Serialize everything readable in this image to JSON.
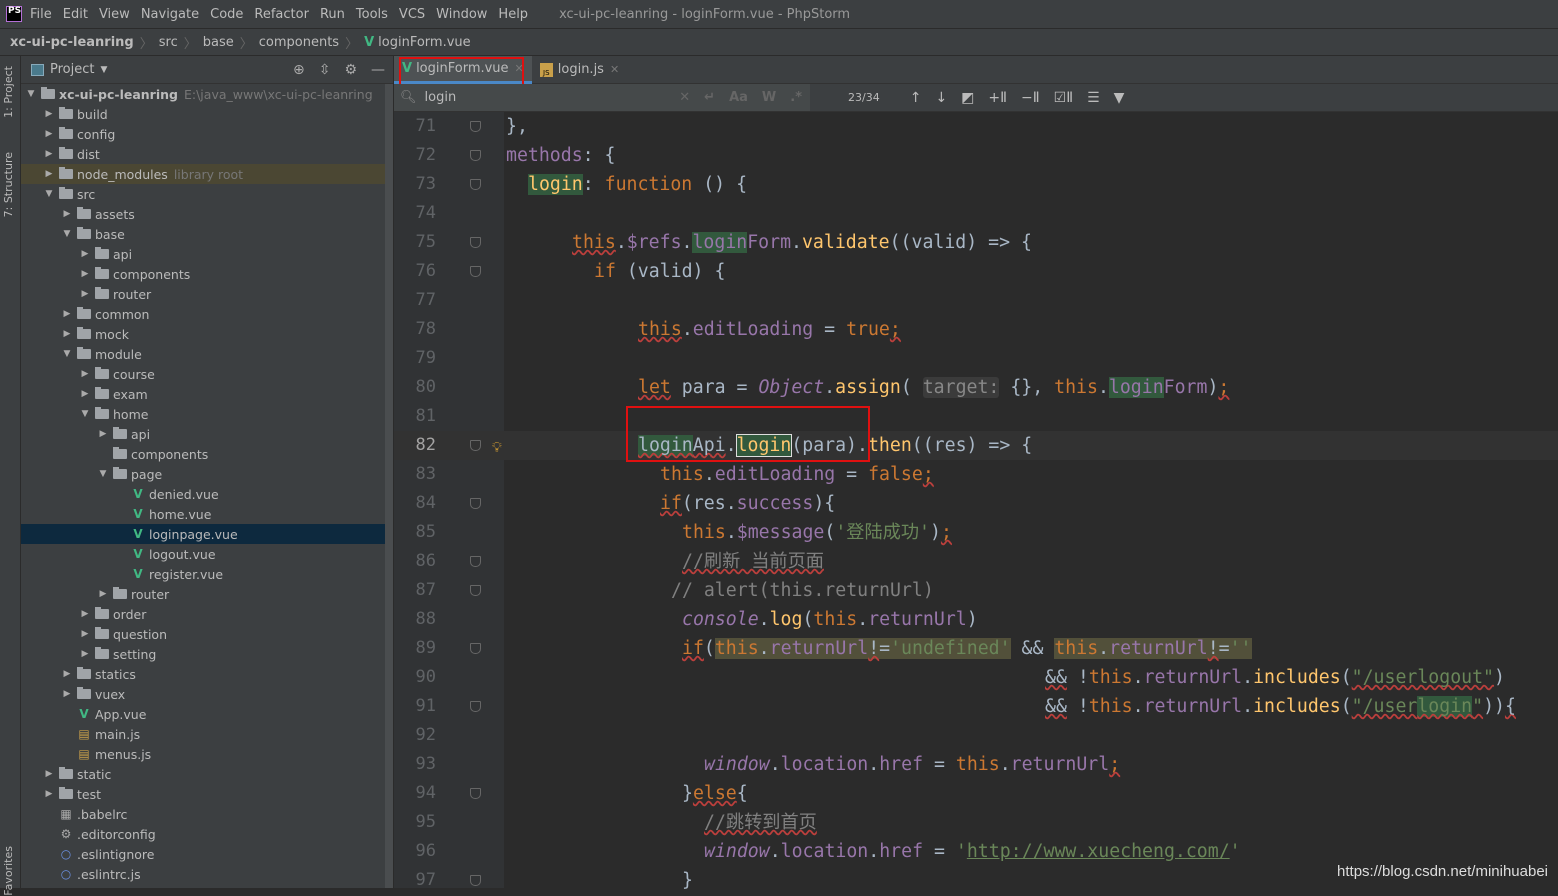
{
  "menubar": {
    "logo": "PS",
    "items": [
      "File",
      "Edit",
      "View",
      "Navigate",
      "Code",
      "Refactor",
      "Run",
      "Tools",
      "VCS",
      "Window",
      "Help"
    ],
    "title": "xc-ui-pc-leanring - loginForm.vue - PhpStorm"
  },
  "breadcrumb": [
    "xc-ui-pc-leanring",
    "src",
    "base",
    "components",
    "loginForm.vue"
  ],
  "side_tabs": {
    "project": "1: Project",
    "structure": "7: Structure",
    "favorites": "Favorites"
  },
  "project_panel": {
    "title": "Project",
    "tools": [
      "locate-icon",
      "collapse-icon",
      "gear-icon",
      "minimize-icon"
    ]
  },
  "tree": [
    {
      "l": 0,
      "t": "folder",
      "n": "xc-ui-pc-leanring",
      "o": true,
      "b": true,
      "x": "E:\\java_www\\xc-ui-pc-leanring"
    },
    {
      "l": 1,
      "t": "folder",
      "n": "build"
    },
    {
      "l": 1,
      "t": "folder",
      "n": "config"
    },
    {
      "l": 1,
      "t": "folder",
      "n": "dist"
    },
    {
      "l": 1,
      "t": "folder",
      "n": "node_modules",
      "x": "library root",
      "hl": true
    },
    {
      "l": 1,
      "t": "folder",
      "n": "src",
      "o": true
    },
    {
      "l": 2,
      "t": "folder",
      "n": "assets"
    },
    {
      "l": 2,
      "t": "folder",
      "n": "base",
      "o": true
    },
    {
      "l": 3,
      "t": "folder",
      "n": "api"
    },
    {
      "l": 3,
      "t": "folder",
      "n": "components"
    },
    {
      "l": 3,
      "t": "folder",
      "n": "router"
    },
    {
      "l": 2,
      "t": "folder",
      "n": "common"
    },
    {
      "l": 2,
      "t": "folder",
      "n": "mock"
    },
    {
      "l": 2,
      "t": "folder",
      "n": "module",
      "o": true
    },
    {
      "l": 3,
      "t": "folder",
      "n": "course"
    },
    {
      "l": 3,
      "t": "folder",
      "n": "exam"
    },
    {
      "l": 3,
      "t": "folder",
      "n": "home",
      "o": true
    },
    {
      "l": 4,
      "t": "folder",
      "n": "api"
    },
    {
      "l": 4,
      "t": "folder",
      "n": "components",
      "na": true
    },
    {
      "l": 4,
      "t": "folder",
      "n": "page",
      "o": true
    },
    {
      "l": 5,
      "t": "vue",
      "n": "denied.vue"
    },
    {
      "l": 5,
      "t": "vue",
      "n": "home.vue"
    },
    {
      "l": 5,
      "t": "vue",
      "n": "loginpage.vue",
      "sel": true
    },
    {
      "l": 5,
      "t": "vue",
      "n": "logout.vue"
    },
    {
      "l": 5,
      "t": "vue",
      "n": "register.vue"
    },
    {
      "l": 4,
      "t": "folder",
      "n": "router"
    },
    {
      "l": 3,
      "t": "folder",
      "n": "order"
    },
    {
      "l": 3,
      "t": "folder",
      "n": "question"
    },
    {
      "l": 3,
      "t": "folder",
      "n": "setting"
    },
    {
      "l": 2,
      "t": "folder",
      "n": "statics"
    },
    {
      "l": 2,
      "t": "folder",
      "n": "vuex"
    },
    {
      "l": 2,
      "t": "vue",
      "n": "App.vue"
    },
    {
      "l": 2,
      "t": "js",
      "n": "main.js"
    },
    {
      "l": 2,
      "t": "js",
      "n": "menus.js"
    },
    {
      "l": 1,
      "t": "folder",
      "n": "static"
    },
    {
      "l": 1,
      "t": "folder",
      "n": "test"
    },
    {
      "l": 1,
      "t": "babel",
      "n": ".babelrc"
    },
    {
      "l": 1,
      "t": "gear",
      "n": ".editorconfig"
    },
    {
      "l": 1,
      "t": "circle",
      "n": ".eslintignore"
    },
    {
      "l": 1,
      "t": "circle",
      "n": ".eslintrc.js"
    }
  ],
  "tabs": [
    {
      "label": "loginForm.vue",
      "icon": "vue",
      "active": true
    },
    {
      "label": "login.js",
      "icon": "js",
      "active": false
    }
  ],
  "search": {
    "query": "login",
    "match_count": "23/34",
    "options": [
      "Aa",
      "W",
      ".*"
    ]
  },
  "code": {
    "current_line": 82,
    "lines": [
      {
        "n": 71,
        "i": 0,
        "s": [
          [
            "d",
            "},"
          ]
        ]
      },
      {
        "n": 72,
        "i": 0,
        "s": [
          [
            "p",
            "methods"
          ],
          [
            "d",
            ": {"
          ]
        ]
      },
      {
        "n": 73,
        "i": 2,
        "s": [
          [
            "f m",
            "login"
          ],
          [
            "d",
            ": "
          ],
          [
            "k",
            "function"
          ],
          [
            "d",
            " () {"
          ]
        ]
      },
      {
        "n": 74,
        "i": 0,
        "s": []
      },
      {
        "n": 75,
        "i": 6,
        "s": [
          [
            "k u",
            "this"
          ],
          [
            "d",
            "."
          ],
          [
            "p",
            "$refs"
          ],
          [
            "d",
            "."
          ],
          [
            "p m",
            "login"
          ],
          [
            "p",
            "Form"
          ],
          [
            "d",
            "."
          ],
          [
            "f",
            "validate"
          ],
          [
            "d",
            "((valid) => {"
          ]
        ]
      },
      {
        "n": 76,
        "i": 8,
        "s": [
          [
            "k",
            "if"
          ],
          [
            "d",
            " (valid) {"
          ]
        ]
      },
      {
        "n": 77,
        "i": 0,
        "s": []
      },
      {
        "n": 78,
        "i": 12,
        "s": [
          [
            "k u",
            "this"
          ],
          [
            "d",
            "."
          ],
          [
            "p",
            "editLoading"
          ],
          [
            "d",
            " = "
          ],
          [
            "k",
            "true"
          ],
          [
            "k u",
            ";"
          ]
        ]
      },
      {
        "n": 79,
        "i": 0,
        "s": []
      },
      {
        "n": 80,
        "i": 12,
        "s": [
          [
            "k u",
            "let"
          ],
          [
            "d",
            " para = "
          ],
          [
            "pi",
            "Object"
          ],
          [
            "d",
            "."
          ],
          [
            "f",
            "assign"
          ],
          [
            "d",
            "( "
          ],
          [
            "hint",
            "target:"
          ],
          [
            "d",
            " {}, "
          ],
          [
            "k",
            "this"
          ],
          [
            "d",
            "."
          ],
          [
            "p m",
            "login"
          ],
          [
            "p",
            "Form"
          ],
          [
            "d",
            ")"
          ],
          [
            "k u",
            ";"
          ]
        ]
      },
      {
        "n": 81,
        "i": 0,
        "s": []
      },
      {
        "n": 82,
        "i": 12,
        "s": [
          [
            "d m u",
            "login"
          ],
          [
            "d u",
            "Api"
          ],
          [
            "d",
            "."
          ],
          [
            "f mb",
            "login"
          ],
          [
            "d",
            "(para)."
          ],
          [
            "f",
            "then"
          ],
          [
            "d",
            "((res) => {"
          ]
        ]
      },
      {
        "n": 83,
        "i": 14,
        "s": [
          [
            "k",
            "this"
          ],
          [
            "d",
            "."
          ],
          [
            "p",
            "editLoading"
          ],
          [
            "d",
            " = "
          ],
          [
            "k",
            "false"
          ],
          [
            "k u",
            ";"
          ]
        ]
      },
      {
        "n": 84,
        "i": 14,
        "s": [
          [
            "k u",
            "if"
          ],
          [
            "d",
            "(res."
          ],
          [
            "p",
            "success"
          ],
          [
            "d",
            "){"
          ]
        ]
      },
      {
        "n": 85,
        "i": 16,
        "s": [
          [
            "k",
            "this"
          ],
          [
            "d",
            "."
          ],
          [
            "p",
            "$message"
          ],
          [
            "d",
            "("
          ],
          [
            "s",
            "'登陆成功'"
          ],
          [
            "d",
            ")"
          ],
          [
            "k u",
            ";"
          ]
        ]
      },
      {
        "n": 86,
        "i": 16,
        "s": [
          [
            "c u",
            "//刷新 当前页面"
          ]
        ]
      },
      {
        "n": 87,
        "i": 15,
        "s": [
          [
            "c",
            "// alert(this.returnUrl)"
          ]
        ]
      },
      {
        "n": 88,
        "i": 16,
        "s": [
          [
            "pi",
            "console"
          ],
          [
            "d",
            "."
          ],
          [
            "f",
            "log"
          ],
          [
            "d",
            "("
          ],
          [
            "k",
            "this"
          ],
          [
            "d",
            "."
          ],
          [
            "p",
            "returnUrl"
          ],
          [
            "d",
            ")"
          ]
        ]
      },
      {
        "n": 89,
        "i": 16,
        "s": [
          [
            "k u",
            "if"
          ],
          [
            "d",
            "("
          ],
          [
            "k y",
            "this"
          ],
          [
            "d y",
            "."
          ],
          [
            "p y",
            "returnUrl"
          ],
          [
            "d y u",
            "!"
          ],
          [
            "d y",
            "="
          ],
          [
            "s y",
            "'undefined'"
          ],
          [
            "d",
            " && "
          ],
          [
            "k y",
            "this"
          ],
          [
            "d y",
            "."
          ],
          [
            "p y",
            "returnUrl"
          ],
          [
            "d y u",
            "!"
          ],
          [
            "d y",
            "="
          ],
          [
            "s y",
            "''"
          ]
        ]
      },
      {
        "n": 90,
        "i": 49,
        "s": [
          [
            "d u",
            "&&"
          ],
          [
            "d",
            " !"
          ],
          [
            "k",
            "this"
          ],
          [
            "d",
            "."
          ],
          [
            "p",
            "returnUrl"
          ],
          [
            "d",
            "."
          ],
          [
            "f",
            "includes"
          ],
          [
            "d",
            "("
          ],
          [
            "s u",
            "\"/userlogout\""
          ],
          [
            "d",
            ")"
          ]
        ]
      },
      {
        "n": 91,
        "i": 49,
        "s": [
          [
            "d u",
            "&&"
          ],
          [
            "d",
            " !"
          ],
          [
            "k",
            "this"
          ],
          [
            "d",
            "."
          ],
          [
            "p",
            "returnUrl"
          ],
          [
            "d",
            "."
          ],
          [
            "f",
            "includes"
          ],
          [
            "d",
            "("
          ],
          [
            "s u",
            "\"/user"
          ],
          [
            "s u m",
            "login"
          ],
          [
            "s u",
            "\""
          ],
          [
            "d",
            "))"
          ],
          [
            "d u",
            "{"
          ]
        ]
      },
      {
        "n": 92,
        "i": 0,
        "s": []
      },
      {
        "n": 93,
        "i": 18,
        "s": [
          [
            "pi",
            "window"
          ],
          [
            "d",
            "."
          ],
          [
            "p",
            "location"
          ],
          [
            "d",
            "."
          ],
          [
            "p",
            "href"
          ],
          [
            "d",
            " = "
          ],
          [
            "k",
            "this"
          ],
          [
            "d",
            "."
          ],
          [
            "p",
            "returnUrl"
          ],
          [
            "k u",
            ";"
          ]
        ]
      },
      {
        "n": 94,
        "i": 16,
        "s": [
          [
            "d",
            "}"
          ],
          [
            "k u",
            "else"
          ],
          [
            "d",
            "{"
          ]
        ]
      },
      {
        "n": 95,
        "i": 18,
        "s": [
          [
            "c u",
            "//跳转到首页"
          ]
        ]
      },
      {
        "n": 96,
        "i": 18,
        "s": [
          [
            "pi",
            "window"
          ],
          [
            "d",
            "."
          ],
          [
            "p",
            "location"
          ],
          [
            "d",
            "."
          ],
          [
            "p",
            "href"
          ],
          [
            "d",
            " = "
          ],
          [
            "s",
            "'"
          ],
          [
            "s lk",
            "http://www.xuecheng.com/"
          ],
          [
            "s",
            "'"
          ]
        ]
      },
      {
        "n": 97,
        "i": 16,
        "s": [
          [
            "d",
            "}"
          ]
        ]
      }
    ]
  },
  "watermark": "https://blog.csdn.net/minihuabei",
  "colors": {
    "keyword": "#cc7832",
    "property": "#9876aa",
    "string": "#6a8759",
    "function": "#ffc66d",
    "text": "#a9b7c6",
    "comment": "#808080",
    "highlight_box": "#e01010"
  }
}
